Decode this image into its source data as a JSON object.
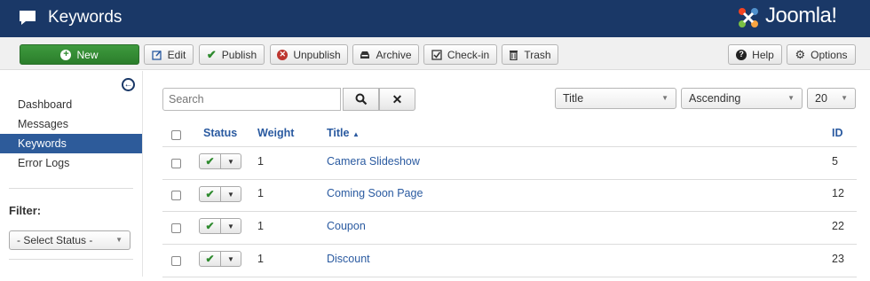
{
  "header": {
    "title": "Keywords",
    "title_icon": "comment-icon",
    "logo_text": "Joomla!",
    "bg_color": "#1a3867"
  },
  "toolbar": {
    "new_label": "New",
    "edit_label": "Edit",
    "publish_label": "Publish",
    "unpublish_label": "Unpublish",
    "archive_label": "Archive",
    "checkin_label": "Check-in",
    "trash_label": "Trash",
    "help_label": "Help",
    "options_label": "Options",
    "new_color": "#2f8a2f"
  },
  "sidebar": {
    "items": [
      {
        "label": "Dashboard",
        "active": false
      },
      {
        "label": "Messages",
        "active": false
      },
      {
        "label": "Keywords",
        "active": true
      },
      {
        "label": "Error Logs",
        "active": false
      }
    ],
    "filter_label": "Filter:",
    "status_select": "- Select Status -"
  },
  "filters": {
    "search_placeholder": "Search",
    "sort_field": "Title",
    "sort_dir": "Ascending",
    "limit": "20"
  },
  "table": {
    "headers": {
      "status": "Status",
      "weight": "Weight",
      "title": "Title",
      "title_sort_indicator": "▲",
      "id": "ID"
    },
    "rows": [
      {
        "weight": "1",
        "title": "Camera Slideshow",
        "id": "5",
        "published": true
      },
      {
        "weight": "1",
        "title": "Coming Soon Page",
        "id": "12",
        "published": true
      },
      {
        "weight": "1",
        "title": "Coupon",
        "id": "22",
        "published": true
      },
      {
        "weight": "1",
        "title": "Discount",
        "id": "23",
        "published": true
      }
    ]
  },
  "colors": {
    "link": "#2a5aa0",
    "active_sidebar": "#2d5b9a",
    "check": "#2e8a2e"
  }
}
